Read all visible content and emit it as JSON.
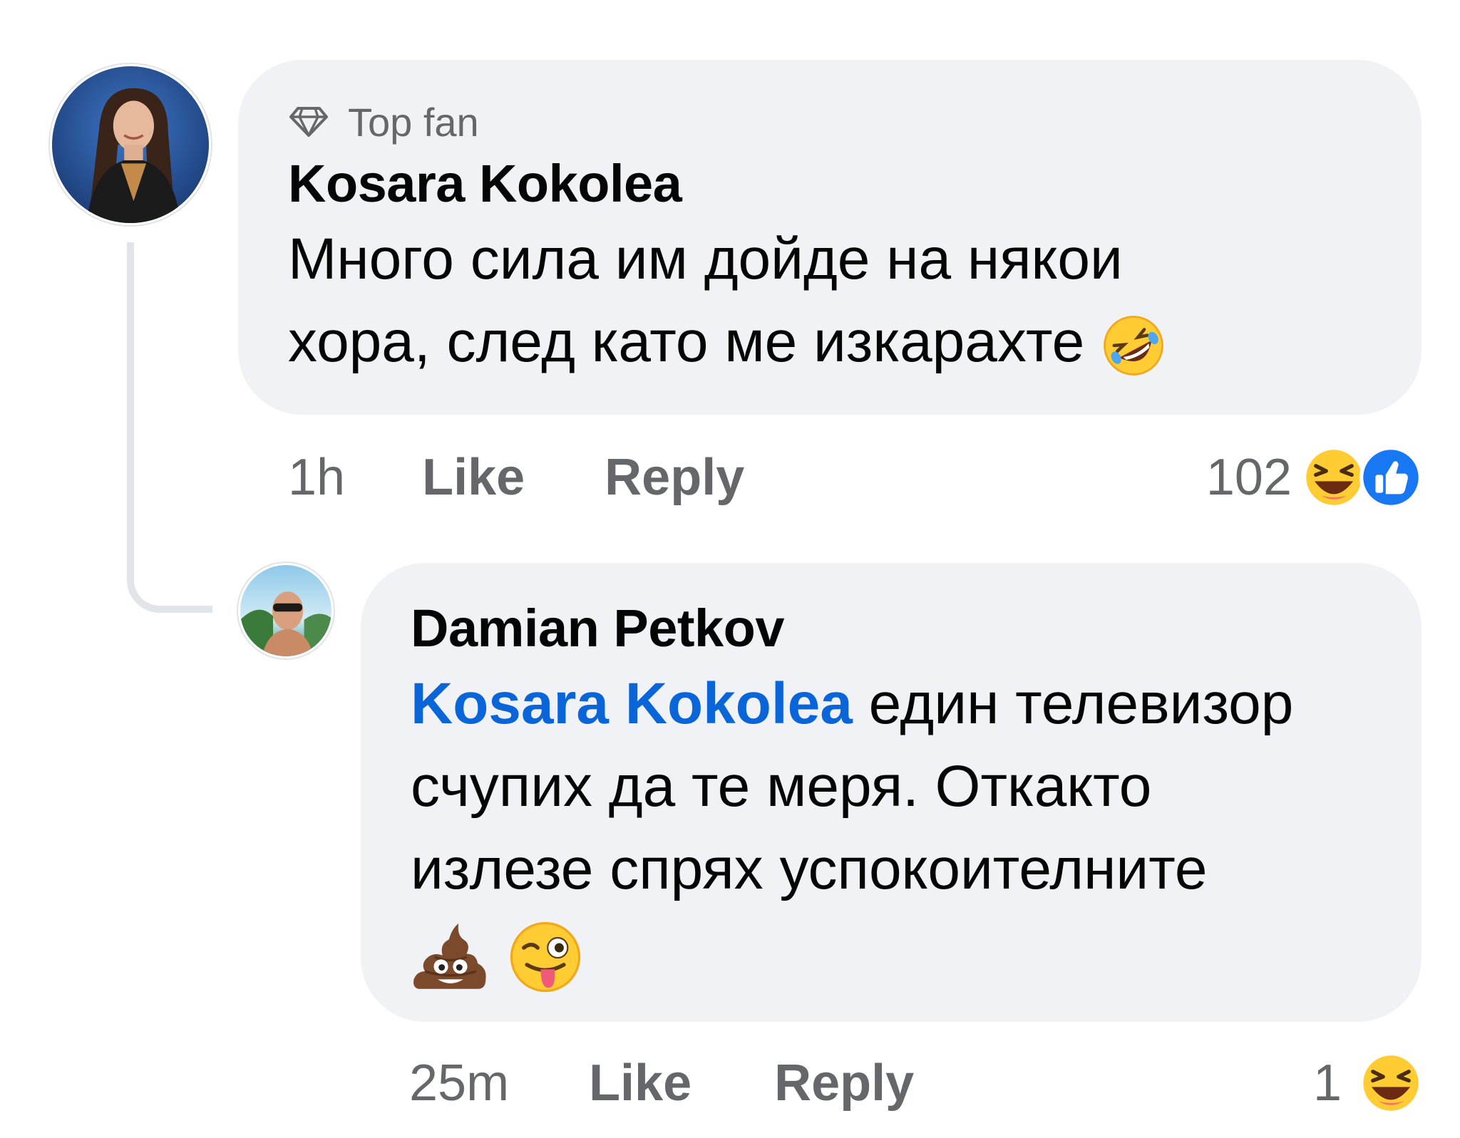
{
  "comment": {
    "badge_label": "Top fan",
    "badge_icon": "diamond-icon",
    "author": "Kosara Kokolea",
    "text_line1": "Много сила им дойде на някои",
    "text_line2": "хора, след като ме изкарахте",
    "text_emoji": "rolling-on-floor-laughing-emoji",
    "time": "1h",
    "like_label": "Like",
    "reply_label": "Reply",
    "reaction_count": "102",
    "reaction_icons": [
      "laughing-reaction-icon",
      "like-reaction-icon"
    ]
  },
  "reply": {
    "author": "Damian Petkov",
    "mention": "Kosara Kokolea",
    "text_line1": "един телевизор",
    "text_line2": "счупих да те меря. Откакто",
    "text_line3": "излезе спрях успокоителните",
    "text_emojis": [
      "pile-of-poo-emoji",
      "winking-face-with-tongue-emoji"
    ],
    "time": "25m",
    "like_label": "Like",
    "reply_label": "Reply",
    "reaction_count": "1",
    "reaction_icons": [
      "laughing-reaction-icon"
    ]
  },
  "colors": {
    "bubble": "#f0f2f5",
    "mention": "#0a66d8",
    "secondary_text": "#65676b",
    "like_blue": "#1877f2"
  }
}
